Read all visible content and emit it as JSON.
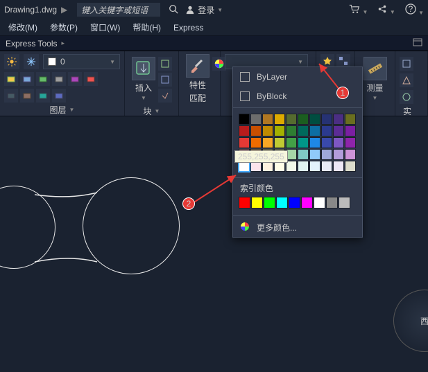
{
  "title": {
    "filename": "Drawing1.dwg",
    "arrow": "▶"
  },
  "search": {
    "placeholder": "键入关键字或短语"
  },
  "login_label": "登录",
  "menus": [
    "修改(M)",
    "参数(P)",
    "窗口(W)",
    "帮助(H)",
    "Express"
  ],
  "toolstrip_tab": "Express Tools",
  "ribbon": {
    "layers": {
      "label": "图层",
      "current_value": "0"
    },
    "insert": {
      "label": "插入",
      "panel_label": "块"
    },
    "props": {
      "label": "特性",
      "sublabel": "匹配"
    },
    "measure": {
      "label": "测量"
    },
    "utils": {
      "label": "实用工具"
    }
  },
  "color_popup": {
    "bylayer": "ByLayer",
    "byblock": "ByBlock",
    "tooltip": "255,255,255",
    "index_title": "索引颜色",
    "more": "更多颜色...",
    "rows": [
      [
        "#000000",
        "#6d6d6d",
        "#b07722",
        "#ddaa00",
        "#556b2f",
        "#1b5e20",
        "#004d40",
        "#263273",
        "#4b2e83",
        "#6a6f1f"
      ],
      [
        "#b71c1c",
        "#c94f00",
        "#c08a00",
        "#a3b000",
        "#2e7d32",
        "#00695c",
        "#0d6ea3",
        "#2b3a8f",
        "#5c2c96",
        "#7b1fa2"
      ],
      [
        "#e53935",
        "#ef6c00",
        "#f9a825",
        "#c0ca33",
        "#43a047",
        "#009688",
        "#1e88e5",
        "#3949ab",
        "#7e57c2",
        "#8e24aa"
      ],
      [
        "#ef9a9a",
        "#ffcc80",
        "#fff59d",
        "#e6ee9c",
        "#a5d6a7",
        "#80cbc4",
        "#90caf9",
        "#9fa8da",
        "#b39ddb",
        "#ce93d8"
      ],
      [
        "#ffffff",
        "#fce4ec",
        "#fff3e0",
        "#fffde7",
        "#f1f8e9",
        "#e0f2f1",
        "#e3f2fd",
        "#e8eaf6",
        "#ede7f6",
        "#dcdccc"
      ]
    ],
    "index_colors": [
      "#ff0000",
      "#ffff00",
      "#00ff00",
      "#00ffff",
      "#0000ff",
      "#ff00ff",
      "#ffffff",
      "#888888",
      "#bbbbbb"
    ]
  },
  "annotations": {
    "a1": "1",
    "a2": "2"
  },
  "viewcube": {
    "face": "西"
  }
}
